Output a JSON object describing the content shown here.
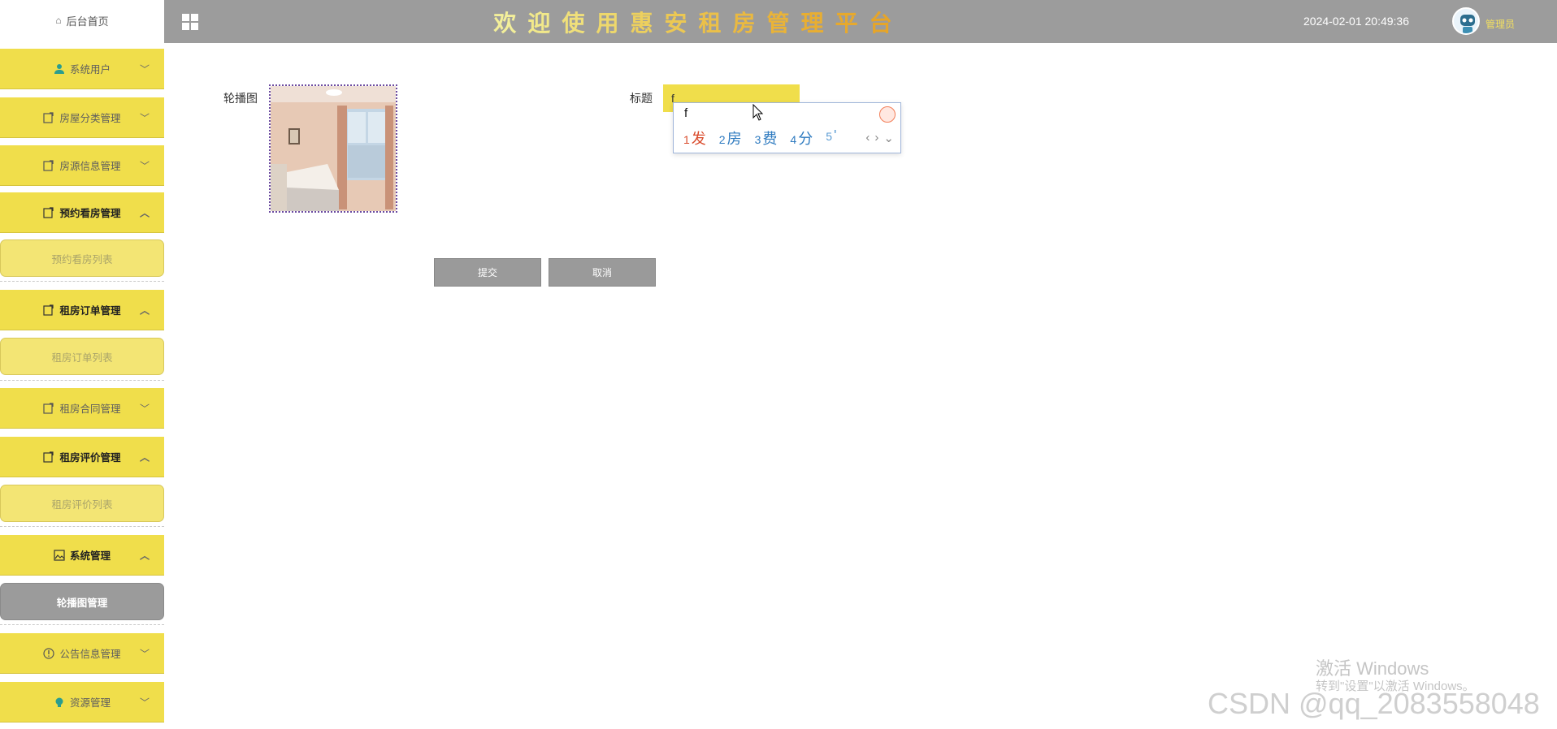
{
  "sidebar": {
    "home_label": "后台首页",
    "menus": [
      {
        "label": "系统用户",
        "icon": "user-icon"
      },
      {
        "label": "房屋分类管理",
        "icon": "edit-icon"
      },
      {
        "label": "房源信息管理",
        "icon": "edit-icon"
      },
      {
        "label": "预约看房管理",
        "icon": "edit-icon",
        "submenu": "预约看房列表"
      },
      {
        "label": "租房订单管理",
        "icon": "edit-icon",
        "submenu": "租房订单列表"
      },
      {
        "label": "租房合同管理",
        "icon": "edit-icon"
      },
      {
        "label": "租房评价管理",
        "icon": "edit-icon",
        "submenu": "租房评价列表"
      },
      {
        "label": "系统管理",
        "icon": "image-icon",
        "submenu": "轮播图管理"
      },
      {
        "label": "公告信息管理",
        "icon": "info-icon"
      },
      {
        "label": "资源管理",
        "icon": "bulb-icon"
      }
    ]
  },
  "header": {
    "title": "欢迎使用惠安租房管理平台",
    "datetime": "2024-02-01 20:49:36",
    "user": "管理员"
  },
  "form": {
    "carousel_label": "轮播图",
    "title_label": "标题",
    "title_value": "f",
    "submit_label": "提交",
    "cancel_label": "取消"
  },
  "ime": {
    "composition": "f",
    "candidates": [
      {
        "num": "1",
        "text": "发"
      },
      {
        "num": "2",
        "text": "房"
      },
      {
        "num": "3",
        "text": "费"
      },
      {
        "num": "4",
        "text": "分"
      },
      {
        "num": "5",
        "text": "'"
      }
    ]
  },
  "watermark": {
    "activate_title": "激活 Windows",
    "activate_hint": "转到\"设置\"以激活 Windows。",
    "csdn": "CSDN @qq_2083558048"
  },
  "colors": {
    "menu_bg": "#f0de4b",
    "header_bg": "#9c9c9c",
    "active_sub_bg": "#9b9b9b"
  }
}
